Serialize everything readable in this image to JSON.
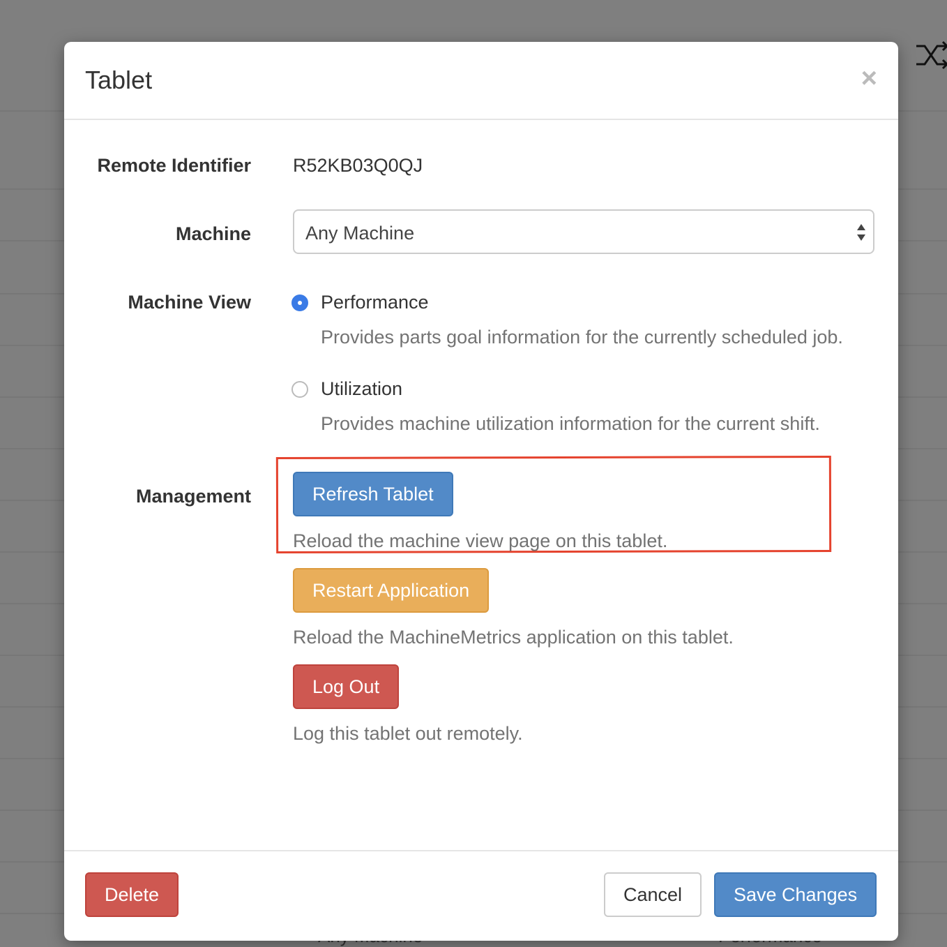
{
  "background": {
    "bottom_left_text": "Any Machine",
    "bottom_right_text": "Performance"
  },
  "modal": {
    "title": "Tablet",
    "close_label": "×"
  },
  "form": {
    "remote_identifier": {
      "label": "Remote Identifier",
      "value": "R52KB03Q0QJ"
    },
    "machine": {
      "label": "Machine",
      "selected": "Any Machine"
    },
    "machine_view": {
      "label": "Machine View",
      "options": [
        {
          "label": "Performance",
          "help": "Provides parts goal information for the currently scheduled job.",
          "checked": true
        },
        {
          "label": "Utilization",
          "help": "Provides machine utilization information for the current shift.",
          "checked": false
        }
      ]
    },
    "management": {
      "label": "Management",
      "actions": [
        {
          "label": "Refresh Tablet",
          "help": "Reload the machine view page on this tablet."
        },
        {
          "label": "Restart Application",
          "help": "Reload the MachineMetrics application on this tablet."
        },
        {
          "label": "Log Out",
          "help": "Log this tablet out remotely."
        }
      ]
    }
  },
  "footer": {
    "delete_label": "Delete",
    "cancel_label": "Cancel",
    "save_label": "Save Changes"
  },
  "colors": {
    "primary": "#528ac8",
    "warning": "#e9ae5a",
    "danger": "#ce5851",
    "highlight": "#e5432e",
    "radio_checked": "#3a7be6"
  }
}
